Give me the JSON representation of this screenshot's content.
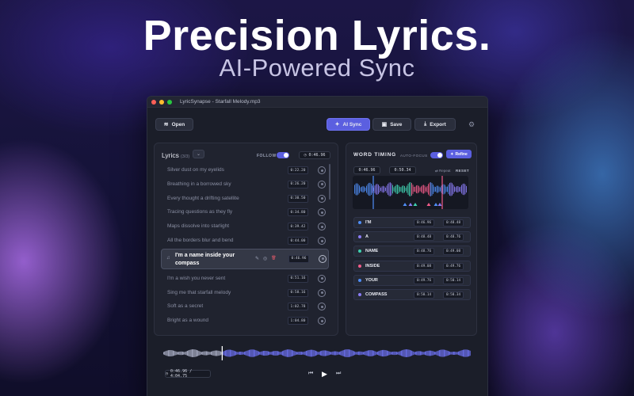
{
  "hero": {
    "title": "Precision Lyrics.",
    "subtitle": "AI-Powered Sync"
  },
  "window": {
    "title": "LyricSynapse - Starfall Melody.mp3"
  },
  "toolbar": {
    "open_label": "Open",
    "ai_sync_label": "AI Sync",
    "save_label": "Save",
    "export_label": "Export"
  },
  "lyrics_panel": {
    "title": "Lyrics",
    "count": "(3/3)",
    "follow_label": "FOLLOW",
    "follow_on": true,
    "current_time": "0:46.96",
    "lines": [
      {
        "text": "Silver dust on my eyelids",
        "time": "0:22.20"
      },
      {
        "text": "Breathing in a borrowed sky",
        "time": "0:26.20"
      },
      {
        "text": "Every thought a drifting satellite",
        "time": "0:30.50"
      },
      {
        "text": "Tracing questions as they fly",
        "time": "0:34.80"
      },
      {
        "text": "Maps dissolve into starlight",
        "time": "0:39.42"
      },
      {
        "text": "All the borders blur and bend",
        "time": "0:44.00"
      },
      {
        "text": "I'm a name inside your compass",
        "time": "0:46.96",
        "active": true
      },
      {
        "text": "I'm a wish you never sent",
        "time": "0:51.16"
      },
      {
        "text": "Sing me that starfall melody",
        "time": "0:58.16"
      },
      {
        "text": "Soft as a secret",
        "time": "1:02.78"
      },
      {
        "text": "Bright as a wound",
        "time": "1:04.80"
      }
    ]
  },
  "word_timing": {
    "title": "WORD TIMING",
    "autofocus_label": "AUTO-FOCUS",
    "autofocus_on": true,
    "refine_label": "Refine",
    "range_start": "0:46.96",
    "range_end": "0:50.34",
    "repeat_label": "Repeat",
    "reset_label": "RESET",
    "words": [
      {
        "word": "I'M",
        "start": "0:46.96",
        "end": "0:48.48",
        "color": "#4f8ef7"
      },
      {
        "word": "A",
        "start": "0:48.48",
        "end": "0:48.76",
        "color": "#8b7cf6"
      },
      {
        "word": "NAME",
        "start": "0:48.76",
        "end": "0:49.08",
        "color": "#3fd0b0"
      },
      {
        "word": "INSIDE",
        "start": "0:49.08",
        "end": "0:49.76",
        "color": "#f25c8a"
      },
      {
        "word": "YOUR",
        "start": "0:49.76",
        "end": "0:50.14",
        "color": "#4f8ef7"
      },
      {
        "word": "COMPASS",
        "start": "0:50.14",
        "end": "0:50.34",
        "color": "#8b7cf6"
      }
    ]
  },
  "player": {
    "time_display": "0:46.96 / 4:04.75",
    "progress": 0.19
  },
  "colors": {
    "accent": "#5b5fe0",
    "panel": "#20232f",
    "window": "#1b1e29"
  }
}
